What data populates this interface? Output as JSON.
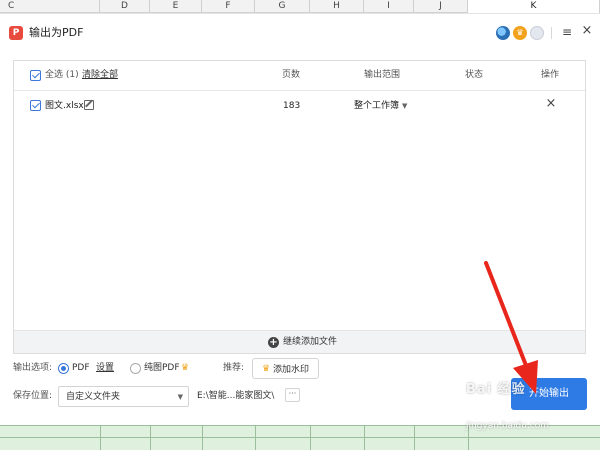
{
  "sheet": {
    "columns": [
      "C",
      "D",
      "E",
      "F",
      "G",
      "H",
      "I",
      "J",
      "K"
    ]
  },
  "dialog": {
    "title": "输出为PDF",
    "app_icon_letter": "P",
    "icons": [
      "user-avatar-icon",
      "crown-icon",
      "settings-icon",
      "menu-icon",
      "close-icon"
    ],
    "menu_glyph": "≡",
    "close_glyph": "×"
  },
  "file_list": {
    "select_all_label": "全选 (1)",
    "clear_all_label": "清除全部",
    "headers": {
      "pages": "页数",
      "range": "输出范围",
      "status": "状态",
      "action": "操作"
    },
    "rows": [
      {
        "checked": true,
        "filename": "图文.xlsx",
        "pages": "183",
        "range": "整个工作簿",
        "status": "",
        "delete_glyph": "×"
      }
    ],
    "add_more_label": "继续添加文件"
  },
  "options": {
    "output_label": "输出选项:",
    "pdf_label": "PDF",
    "settings_link": "设置",
    "image_pdf_label": "纯图PDF",
    "recommend_label": "推荐:",
    "watermark_btn": "添加水印",
    "save_label": "保存位置:",
    "folder_value": "自定义文件夹",
    "path_value": "E:\\智能...能家图文\\",
    "browse_glyph": "···"
  },
  "start_button": "开始输出",
  "watermark_text": "Bai 经验",
  "watermark_url": "jingyan.baidu.com",
  "colors": {
    "accent": "#2e7be6",
    "annotation": "#e8261b",
    "app_red": "#e84a3d",
    "crown": "#f2a21a"
  }
}
